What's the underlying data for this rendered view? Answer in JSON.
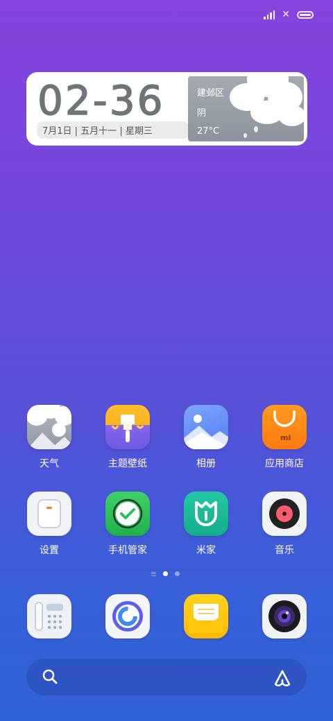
{
  "status_bar": {
    "signal_icon": "signal-bars-icon",
    "network_icon": "x-icon",
    "battery_icon": "battery-icon"
  },
  "clock_widget": {
    "time": "02-36",
    "date_line": "7月1日 | 五月十一 | 星期三",
    "weather": {
      "location": "建邺区",
      "condition": "阴",
      "temperature": "27°C"
    }
  },
  "apps": [
    {
      "label": "天气",
      "icon": "weather-icon"
    },
    {
      "label": "主题壁纸",
      "icon": "themes-icon"
    },
    {
      "label": "相册",
      "icon": "gallery-icon"
    },
    {
      "label": "应用商店",
      "icon": "app-store-icon"
    },
    {
      "label": "设置",
      "icon": "settings-icon"
    },
    {
      "label": "手机管家",
      "icon": "security-icon"
    },
    {
      "label": "米家",
      "icon": "mijia-icon"
    },
    {
      "label": "音乐",
      "icon": "music-icon"
    }
  ],
  "page_indicator": {
    "pages": 2,
    "current": 1
  },
  "dock": [
    "phone-icon",
    "browser-icon",
    "messages-icon",
    "camera-icon"
  ],
  "search_bar": {
    "search_icon": "search-icon",
    "assistant_icon": "assistant-icon"
  },
  "colors": {
    "bg_top": "#8743dd",
    "bg_bottom": "#2f63d6",
    "widget_bg": "#ffffff"
  }
}
